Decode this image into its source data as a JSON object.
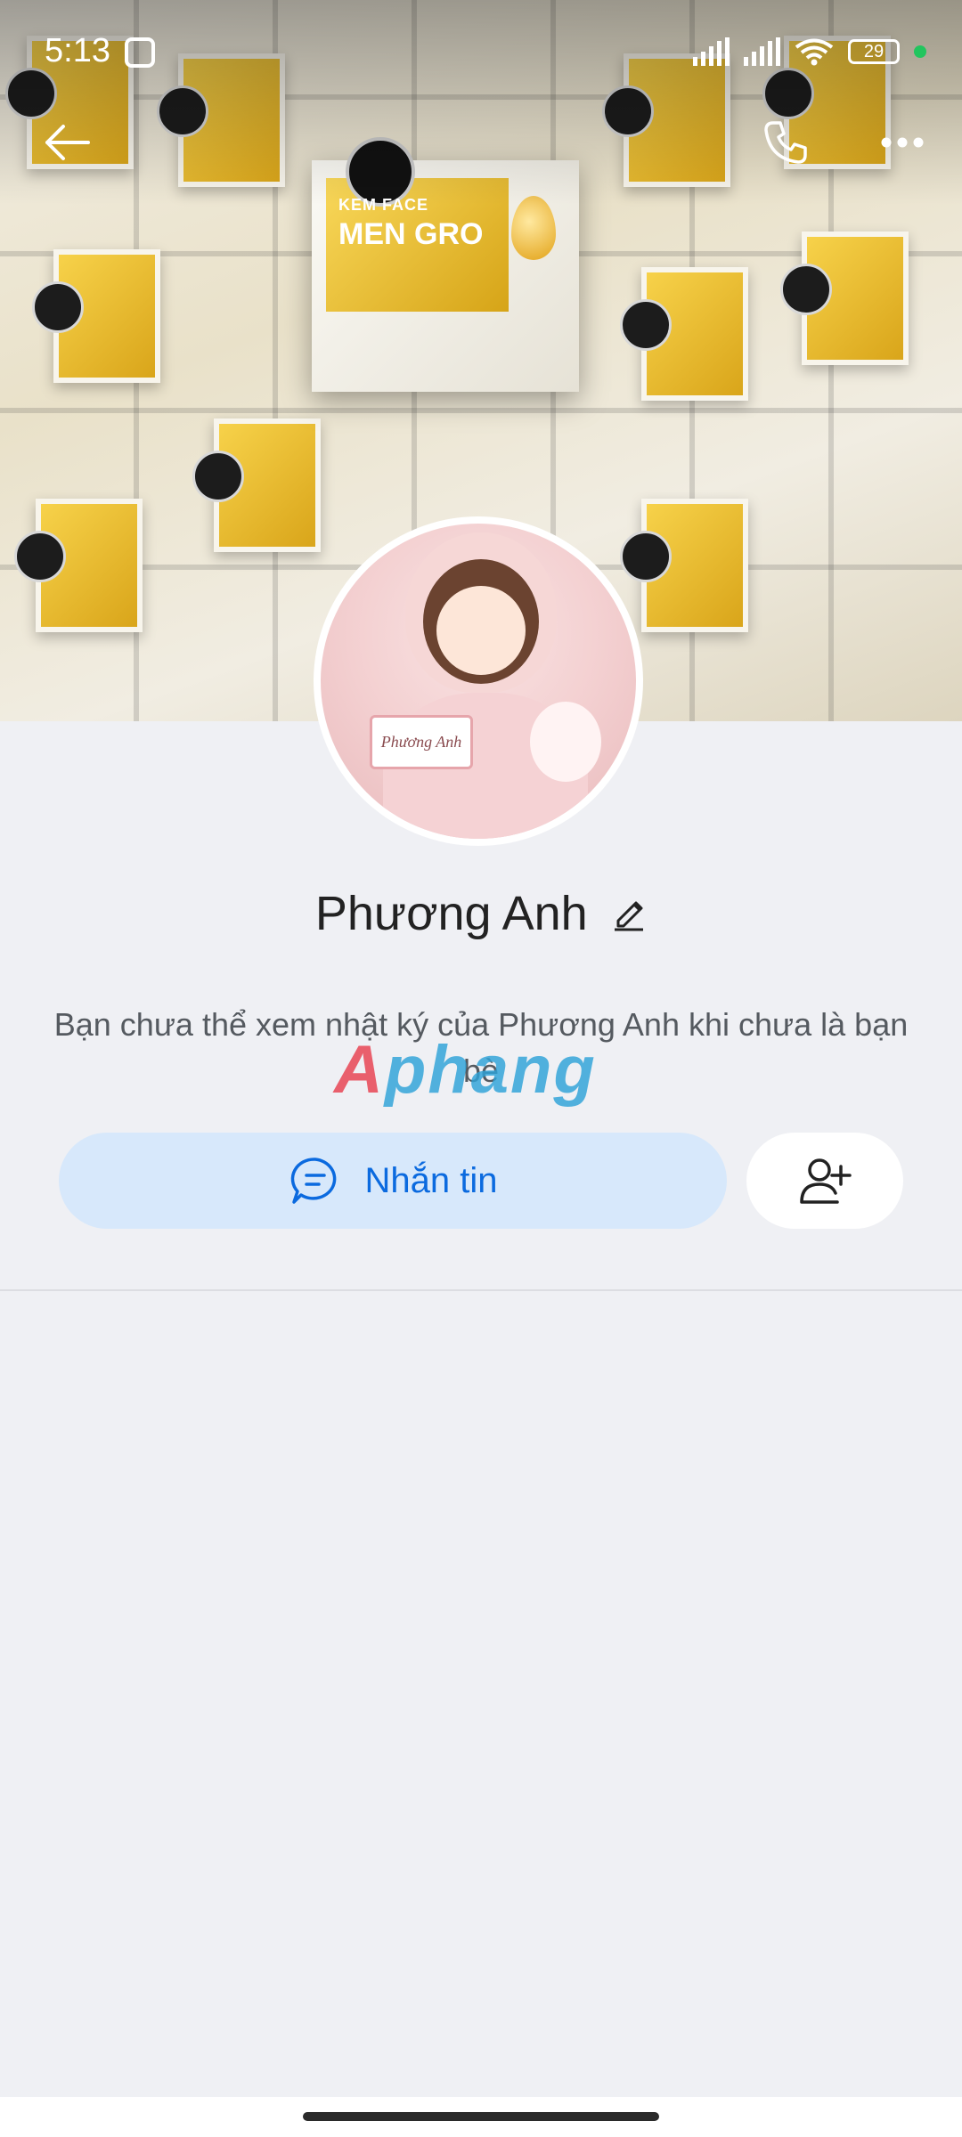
{
  "status_bar": {
    "time": "5:13",
    "battery": "29",
    "icons": [
      "face-icon",
      "signal-icon",
      "signal-icon",
      "wifi-icon",
      "battery-icon",
      "green-dot"
    ]
  },
  "header": {
    "back_icon": "arrow-left-icon",
    "call_icon": "phone-icon",
    "more_icon": "ellipsis-icon"
  },
  "cover": {
    "print_brand": "KEM FACE",
    "print_product": "MEN GRO"
  },
  "avatar": {
    "sign_text": "Phương Anh"
  },
  "profile": {
    "name": "Phương Anh",
    "edit_icon": "pencil-icon"
  },
  "notice": {
    "text": "Bạn chưa thể xem nhật ký của Phương Anh khi chưa là bạn bè"
  },
  "watermark": {
    "text_a": "A",
    "text_rest": "phang"
  },
  "actions": {
    "message_label": "Nhắn tin",
    "message_icon": "chat-bubble-icon",
    "add_friend_icon": "user-add-icon"
  },
  "colors": {
    "accent": "#0b6adf",
    "button_bg": "#d7e8fb",
    "page_bg": "#eff0f4"
  }
}
